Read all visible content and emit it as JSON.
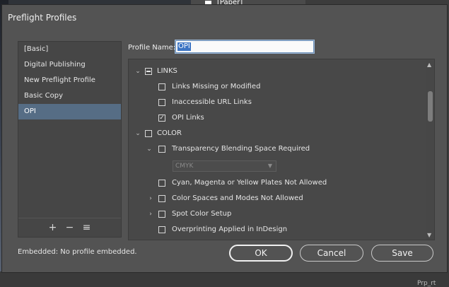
{
  "background": {
    "paper_label": "[Paper]",
    "bottom_text": "Prp_rt"
  },
  "dialog": {
    "title": "Preflight Profiles"
  },
  "profiles": {
    "items": [
      {
        "label": "[Basic]",
        "selected": false
      },
      {
        "label": "Digital Publishing",
        "selected": false
      },
      {
        "label": "New Preflight Profile",
        "selected": false
      },
      {
        "label": "Basic Copy",
        "selected": false
      },
      {
        "label": "OPI",
        "selected": true
      }
    ],
    "tools": {
      "add": "+",
      "remove": "−",
      "menu": "≡"
    }
  },
  "embedded_status": "Embedded:  No profile embedded.",
  "profile_name": {
    "label": "Profile Name:",
    "value": "OPI"
  },
  "tree": {
    "links": {
      "label": "LINKS",
      "state": "mixed",
      "children": [
        {
          "label": "Links Missing or Modified",
          "checked": false
        },
        {
          "label": "Inaccessible URL Links",
          "checked": false
        },
        {
          "label": "OPI Links",
          "checked": true
        }
      ]
    },
    "color": {
      "label": "COLOR",
      "state": "unchecked",
      "children": [
        {
          "label": "Transparency Blending Space Required",
          "checked": false,
          "expanded": true,
          "option": "CMYK"
        },
        {
          "label": "Cyan, Magenta or Yellow Plates Not Allowed",
          "checked": false
        },
        {
          "label": "Color Spaces and Modes Not Allowed",
          "checked": false,
          "expandable": true
        },
        {
          "label": "Spot Color Setup",
          "checked": false,
          "expandable": true
        },
        {
          "label": "Overprinting Applied in InDesign",
          "checked": false
        }
      ]
    }
  },
  "buttons": {
    "ok": "OK",
    "cancel": "Cancel",
    "save": "Save"
  },
  "colors": {
    "dialog_bg": "#535353",
    "selection": "#566d85",
    "text_highlight": "#3d75c4"
  }
}
